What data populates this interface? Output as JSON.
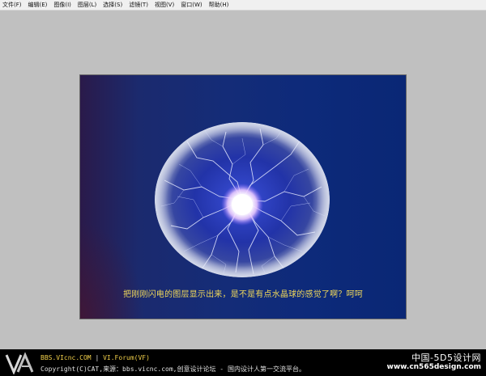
{
  "menu": {
    "items": [
      {
        "label": "文件(F)"
      },
      {
        "label": "编辑(E)"
      },
      {
        "label": "图像(I)"
      },
      {
        "label": "图层(L)"
      },
      {
        "label": "选择(S)"
      },
      {
        "label": "滤镜(T)"
      },
      {
        "label": "视图(V)"
      },
      {
        "label": "窗口(W)"
      },
      {
        "label": "帮助(H)"
      }
    ]
  },
  "canvas": {
    "caption": "把刚刚闪电的图层显示出来，是不是有点水晶球的感觉了啊？呵呵",
    "image": "plasma-crystal-ball"
  },
  "footer": {
    "logo": "VA",
    "line1_site": "BBS.VIcnc.COM",
    "line1_sep": "|",
    "line1_forum": "VI.Forum(VF)",
    "line2": "Copyright(C)CAT,来源：bbs.vicnc.com,创意设计论坛 - 国内设计人第一交流平台。",
    "watermark_title": "中国-5D5设计网",
    "watermark_url": "www.cn565design.com"
  },
  "colors": {
    "workspace_bg": "#c0c0c0",
    "canvas_bg": "#0d2a7a",
    "caption": "#f0d85a",
    "footer_bg": "#000000"
  }
}
